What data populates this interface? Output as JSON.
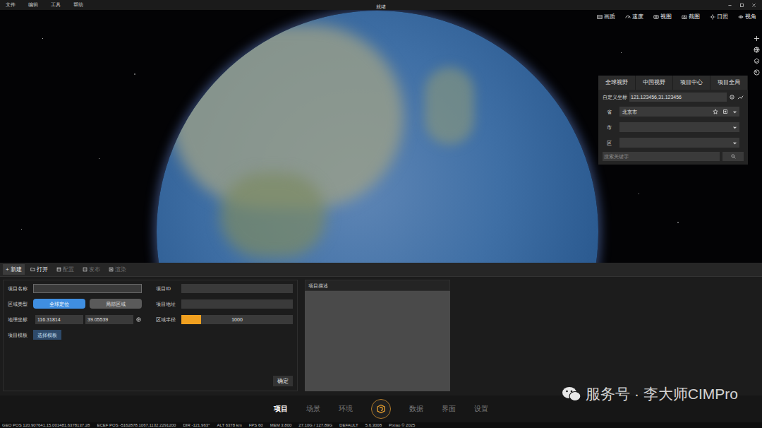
{
  "window": {
    "title": "就绪",
    "menu": [
      "文件",
      "编辑",
      "工具",
      "帮助"
    ]
  },
  "toolbar": [
    "画质",
    "速度",
    "视图",
    "截图",
    "日照",
    "视角"
  ],
  "view_panel": {
    "tabs": [
      {
        "label": "全球视野",
        "selected": false
      },
      {
        "label": "中国视野",
        "selected": false
      },
      {
        "label": "项目中心",
        "selected": false
      },
      {
        "label": "项目全局",
        "selected": false
      }
    ],
    "custom_coord": {
      "label": "自定义坐标",
      "value": "121.123456,31.123456"
    },
    "province": {
      "label": "省",
      "value": "北京市"
    },
    "city": {
      "label": "市",
      "value": ""
    },
    "district": {
      "label": "区",
      "value": ""
    },
    "search": {
      "placeholder": "搜索关键字"
    }
  },
  "project_toolbar": [
    {
      "label": "+ 新建",
      "selected": true,
      "disabled": false
    },
    {
      "label": "打开",
      "selected": false,
      "disabled": false
    },
    {
      "label": "配置",
      "selected": false,
      "disabled": true
    },
    {
      "label": "发布",
      "selected": false,
      "disabled": true
    },
    {
      "label": "渲染",
      "selected": false,
      "disabled": true
    }
  ],
  "form": {
    "name": {
      "label": "项目名称",
      "value": "",
      "focused": true
    },
    "id": {
      "label": "项目ID",
      "value": ""
    },
    "region_type": {
      "label": "区域类型",
      "options": [
        {
          "label": "全球定位",
          "selected": true
        },
        {
          "label": "局部区域",
          "selected": false
        }
      ]
    },
    "address": {
      "label": "项目地址",
      "value": ""
    },
    "coords": {
      "label": "地理坐标",
      "lon": "116.31814",
      "lat": "39.05539"
    },
    "radius": {
      "label": "区域半径",
      "level": 0.18,
      "reading": "1000"
    },
    "template": {
      "label": "项目模板",
      "button": "选择模板"
    },
    "description": {
      "label": "项目描述",
      "value": ""
    },
    "confirm": "确定"
  },
  "nav": [
    {
      "label": "项目",
      "selected": true
    },
    {
      "label": "场景",
      "selected": false
    },
    {
      "label": "环境",
      "selected": false
    },
    {
      "label": "数据",
      "selected": false
    },
    {
      "label": "界面",
      "selected": false
    },
    {
      "label": "设置",
      "selected": false
    }
  ],
  "status_bar": [
    "GEO POS 120.907641,15.001481,6378137.28",
    "ECEF POS -5162878.1067,1132.2291200",
    "DIR -121.963°",
    "ALT 6378 km",
    "FPS 60",
    "MEM 3.800",
    "27.10G / 127.89G",
    "DEFAULT",
    "5.6.3008",
    "Pixiao © 2025"
  ],
  "watermark": "服务号 · 李大师CIMPro"
}
